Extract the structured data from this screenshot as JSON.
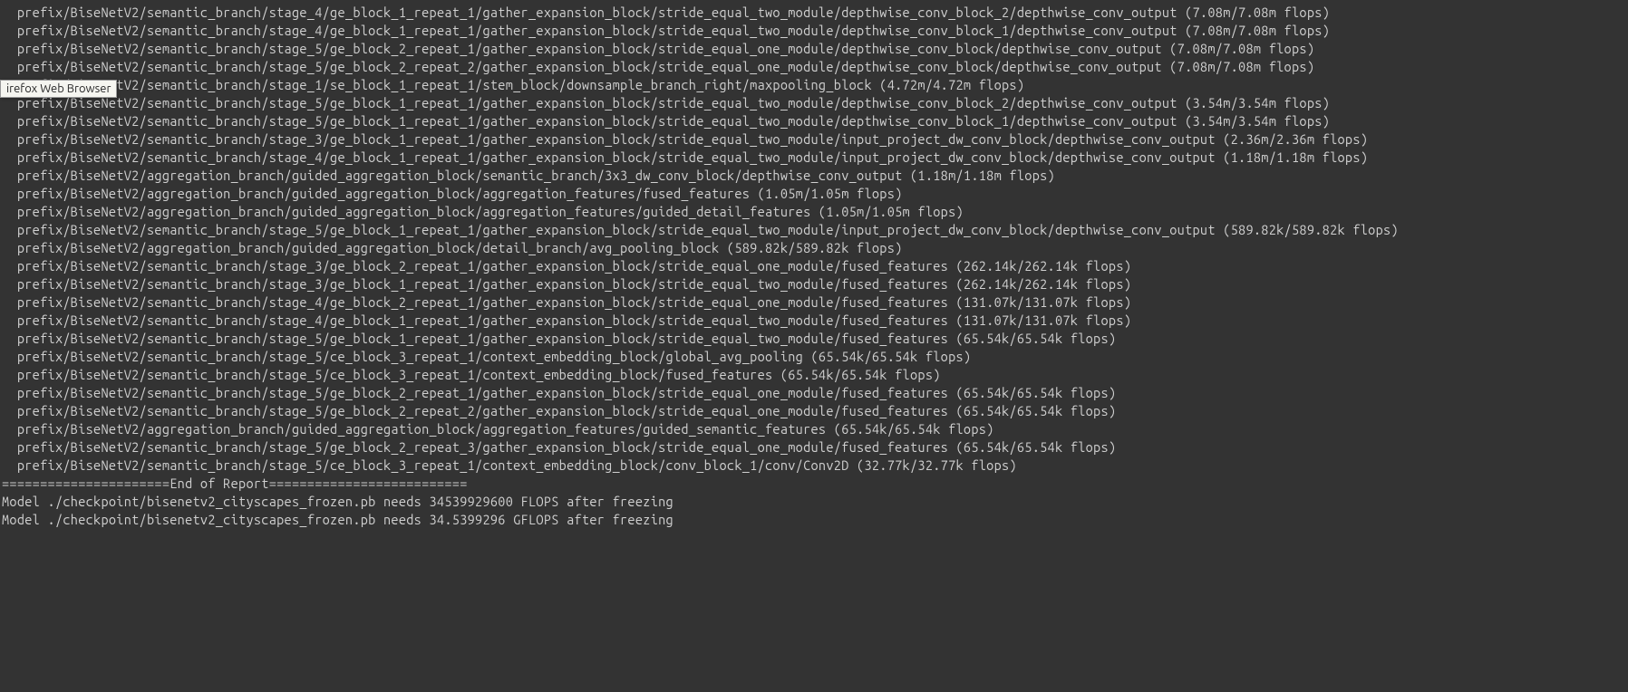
{
  "tooltip": "irefox Web Browser",
  "terminal": {
    "lines": [
      "  prefix/BiseNetV2/semantic_branch/stage_4/ge_block_1_repeat_1/gather_expansion_block/stride_equal_two_module/depthwise_conv_block_2/depthwise_conv_output (7.08m/7.08m flops)",
      "  prefix/BiseNetV2/semantic_branch/stage_4/ge_block_1_repeat_1/gather_expansion_block/stride_equal_two_module/depthwise_conv_block_1/depthwise_conv_output (7.08m/7.08m flops)",
      "  prefix/BiseNetV2/semantic_branch/stage_5/ge_block_2_repeat_1/gather_expansion_block/stride_equal_one_module/depthwise_conv_block/depthwise_conv_output (7.08m/7.08m flops)",
      "  prefix/BiseNetV2/semantic_branch/stage_5/ge_block_2_repeat_2/gather_expansion_block/stride_equal_one_module/depthwise_conv_block/depthwise_conv_output (7.08m/7.08m flops)",
      "  prefix/BiseNetV2/semantic_branch/stage_1/se_block_1_repeat_1/stem_block/downsample_branch_right/maxpooling_block (4.72m/4.72m flops)",
      "  prefix/BiseNetV2/semantic_branch/stage_5/ge_block_1_repeat_1/gather_expansion_block/stride_equal_two_module/depthwise_conv_block_2/depthwise_conv_output (3.54m/3.54m flops)",
      "  prefix/BiseNetV2/semantic_branch/stage_5/ge_block_1_repeat_1/gather_expansion_block/stride_equal_two_module/depthwise_conv_block_1/depthwise_conv_output (3.54m/3.54m flops)",
      "  prefix/BiseNetV2/semantic_branch/stage_3/ge_block_1_repeat_1/gather_expansion_block/stride_equal_two_module/input_project_dw_conv_block/depthwise_conv_output (2.36m/2.36m flops)",
      "  prefix/BiseNetV2/semantic_branch/stage_4/ge_block_1_repeat_1/gather_expansion_block/stride_equal_two_module/input_project_dw_conv_block/depthwise_conv_output (1.18m/1.18m flops)",
      "  prefix/BiseNetV2/aggregation_branch/guided_aggregation_block/semantic_branch/3x3_dw_conv_block/depthwise_conv_output (1.18m/1.18m flops)",
      "  prefix/BiseNetV2/aggregation_branch/guided_aggregation_block/aggregation_features/fused_features (1.05m/1.05m flops)",
      "  prefix/BiseNetV2/aggregation_branch/guided_aggregation_block/aggregation_features/guided_detail_features (1.05m/1.05m flops)",
      "  prefix/BiseNetV2/semantic_branch/stage_5/ge_block_1_repeat_1/gather_expansion_block/stride_equal_two_module/input_project_dw_conv_block/depthwise_conv_output (589.82k/589.82k flops)",
      "  prefix/BiseNetV2/aggregation_branch/guided_aggregation_block/detail_branch/avg_pooling_block (589.82k/589.82k flops)",
      "  prefix/BiseNetV2/semantic_branch/stage_3/ge_block_2_repeat_1/gather_expansion_block/stride_equal_one_module/fused_features (262.14k/262.14k flops)",
      "  prefix/BiseNetV2/semantic_branch/stage_3/ge_block_1_repeat_1/gather_expansion_block/stride_equal_two_module/fused_features (262.14k/262.14k flops)",
      "  prefix/BiseNetV2/semantic_branch/stage_4/ge_block_2_repeat_1/gather_expansion_block/stride_equal_one_module/fused_features (131.07k/131.07k flops)",
      "  prefix/BiseNetV2/semantic_branch/stage_4/ge_block_1_repeat_1/gather_expansion_block/stride_equal_two_module/fused_features (131.07k/131.07k flops)",
      "  prefix/BiseNetV2/semantic_branch/stage_5/ge_block_1_repeat_1/gather_expansion_block/stride_equal_two_module/fused_features (65.54k/65.54k flops)",
      "  prefix/BiseNetV2/semantic_branch/stage_5/ce_block_3_repeat_1/context_embedding_block/global_avg_pooling (65.54k/65.54k flops)",
      "  prefix/BiseNetV2/semantic_branch/stage_5/ce_block_3_repeat_1/context_embedding_block/fused_features (65.54k/65.54k flops)",
      "  prefix/BiseNetV2/semantic_branch/stage_5/ge_block_2_repeat_1/gather_expansion_block/stride_equal_one_module/fused_features (65.54k/65.54k flops)",
      "  prefix/BiseNetV2/semantic_branch/stage_5/ge_block_2_repeat_2/gather_expansion_block/stride_equal_one_module/fused_features (65.54k/65.54k flops)",
      "  prefix/BiseNetV2/aggregation_branch/guided_aggregation_block/aggregation_features/guided_semantic_features (65.54k/65.54k flops)",
      "  prefix/BiseNetV2/semantic_branch/stage_5/ge_block_2_repeat_3/gather_expansion_block/stride_equal_one_module/fused_features (65.54k/65.54k flops)",
      "  prefix/BiseNetV2/semantic_branch/stage_5/ce_block_3_repeat_1/context_embedding_block/conv_block_1/conv/Conv2D (32.77k/32.77k flops)",
      "",
      "======================End of Report==========================",
      "Model ./checkpoint/bisenetv2_cityscapes_frozen.pb needs 34539929600 FLOPS after freezing",
      "Model ./checkpoint/bisenetv2_cityscapes_frozen.pb needs 34.5399296 GFLOPS after freezing"
    ]
  }
}
